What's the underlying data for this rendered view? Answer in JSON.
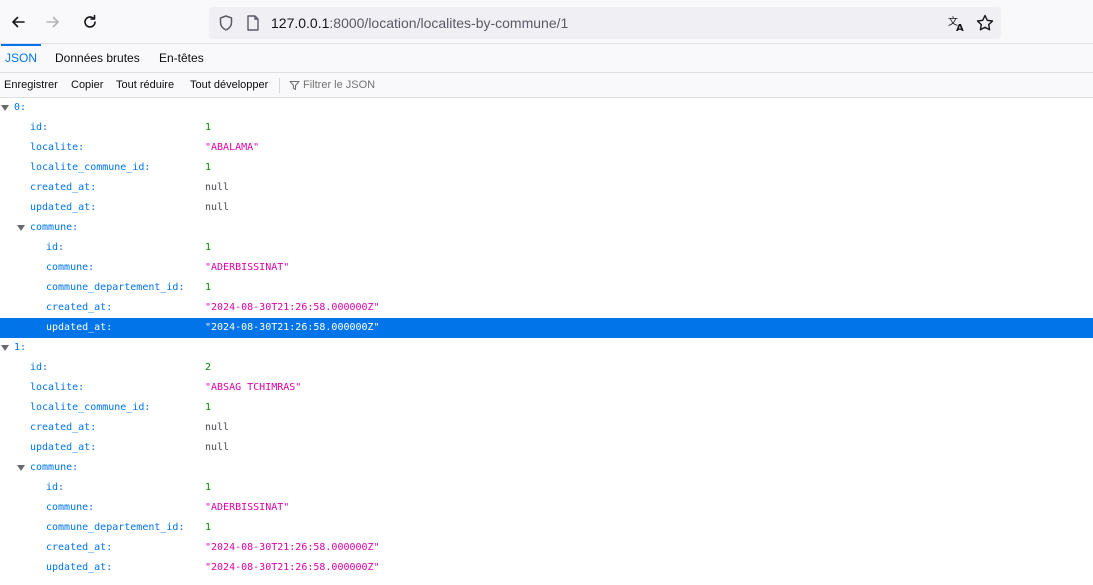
{
  "browser": {
    "url_host": "127.0.0.1",
    "url_rest": ":8000/location/localites-by-commune/1"
  },
  "viewer_tabs": [
    "JSON",
    "Données brutes",
    "En-têtes"
  ],
  "actions": {
    "save": "Enregistrer",
    "copy": "Copier",
    "collapse_all": "Tout réduire",
    "expand_all": "Tout développer",
    "filter_placeholder": "Filtrer le JSON"
  },
  "json_rows": [
    {
      "key": "0:",
      "value": "",
      "type": "index",
      "level": 0,
      "expandable": true
    },
    {
      "key": "id:",
      "value": "1",
      "type": "number",
      "level": 1
    },
    {
      "key": "localite:",
      "value": "\"ABALAMA\"",
      "type": "string",
      "level": 1
    },
    {
      "key": "localite_commune_id:",
      "value": "1",
      "type": "number",
      "level": 1
    },
    {
      "key": "created_at:",
      "value": "null",
      "type": "null",
      "level": 1
    },
    {
      "key": "updated_at:",
      "value": "null",
      "type": "null",
      "level": 1
    },
    {
      "key": "commune:",
      "value": "",
      "type": "object",
      "level": 1,
      "expandable": true
    },
    {
      "key": "id:",
      "value": "1",
      "type": "number",
      "level": 2
    },
    {
      "key": "commune:",
      "value": "\"ADERBISSINAT\"",
      "type": "string",
      "level": 2
    },
    {
      "key": "commune_departement_id:",
      "value": "1",
      "type": "number",
      "level": 2
    },
    {
      "key": "created_at:",
      "value": "\"2024-08-30T21:26:58.000000Z\"",
      "type": "string",
      "level": 2
    },
    {
      "key": "updated_at:",
      "value": "\"2024-08-30T21:26:58.000000Z\"",
      "type": "string",
      "level": 2,
      "selected": true
    },
    {
      "key": "1:",
      "value": "",
      "type": "index",
      "level": 0,
      "expandable": true
    },
    {
      "key": "id:",
      "value": "2",
      "type": "number",
      "level": 1
    },
    {
      "key": "localite:",
      "value": "\"ABSAG TCHIMRAS\"",
      "type": "string",
      "level": 1
    },
    {
      "key": "localite_commune_id:",
      "value": "1",
      "type": "number",
      "level": 1
    },
    {
      "key": "created_at:",
      "value": "null",
      "type": "null",
      "level": 1
    },
    {
      "key": "updated_at:",
      "value": "null",
      "type": "null",
      "level": 1
    },
    {
      "key": "commune:",
      "value": "",
      "type": "object",
      "level": 1,
      "expandable": true
    },
    {
      "key": "id:",
      "value": "1",
      "type": "number",
      "level": 2
    },
    {
      "key": "commune:",
      "value": "\"ADERBISSINAT\"",
      "type": "string",
      "level": 2
    },
    {
      "key": "commune_departement_id:",
      "value": "1",
      "type": "number",
      "level": 2
    },
    {
      "key": "created_at:",
      "value": "\"2024-08-30T21:26:58.000000Z\"",
      "type": "string",
      "level": 2
    },
    {
      "key": "updated_at:",
      "value": "\"2024-08-30T21:26:58.000000Z\"",
      "type": "string",
      "level": 2
    }
  ]
}
